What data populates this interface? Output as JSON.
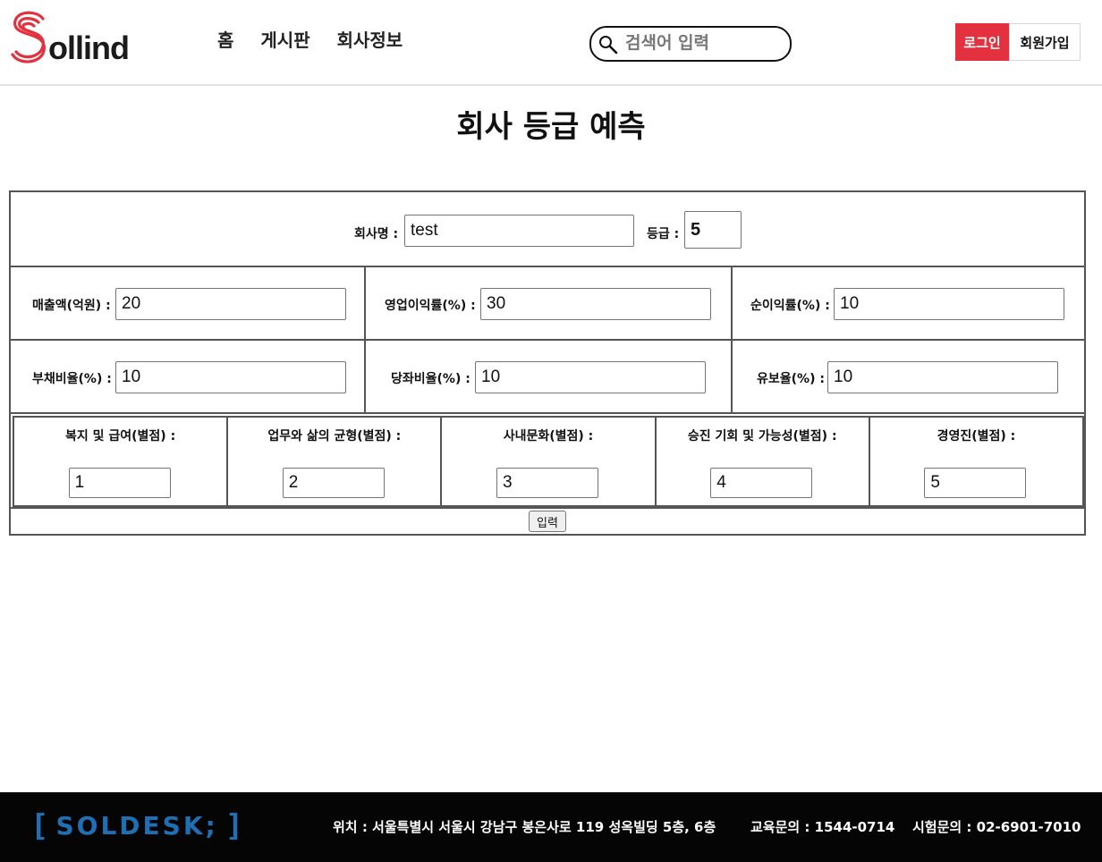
{
  "brand": {
    "logo_text": "ollind",
    "logo_color": "#e3313f"
  },
  "nav": {
    "items": [
      "홈",
      "게시판",
      "회사정보"
    ]
  },
  "search": {
    "placeholder": "검색어 입력",
    "icon": "search-icon"
  },
  "auth": {
    "login_label": "로그인",
    "signup_label": "회원가입",
    "login_color": "#e3313f"
  },
  "page": {
    "title": "회사 등급 예측"
  },
  "form": {
    "company_name": {
      "label": "회사명 :",
      "value": "test"
    },
    "grade": {
      "label": "등급 :",
      "value": "5"
    },
    "revenue": {
      "label": "매출액(억원) :",
      "value": "20"
    },
    "operating_margin": {
      "label": "영업이익률(%) :",
      "value": "30"
    },
    "net_margin": {
      "label": "순이익률(%) :",
      "value": "10"
    },
    "debt_ratio": {
      "label": "부채비율(%) :",
      "value": "10"
    },
    "current_ratio": {
      "label": "당좌비율(%) :",
      "value": "10"
    },
    "reserve_ratio": {
      "label": "유보율(%) :",
      "value": "10"
    },
    "ratings": [
      {
        "label": "복지 및 급여(별점) :",
        "value": "1"
      },
      {
        "label": "업무와 삶의 균형(별점) :",
        "value": "2"
      },
      {
        "label": "사내문화(별점) :",
        "value": "3"
      },
      {
        "label": "승진 기회 및 가능성(별점) :",
        "value": "4"
      },
      {
        "label": "경영진(별점) :",
        "value": "5"
      }
    ],
    "submit_label": "입력"
  },
  "footer": {
    "logo_text": "SOLDESK;",
    "address": "위치 : 서울특별시 서울시 강남구 봉은사로 119 성옥빌딩 5층, 6층",
    "education_contact": "교육문의 : 1544-0714",
    "exam_contact": "시험문의 : 02-6901-7010",
    "logo_color": "#1f6fb5"
  }
}
